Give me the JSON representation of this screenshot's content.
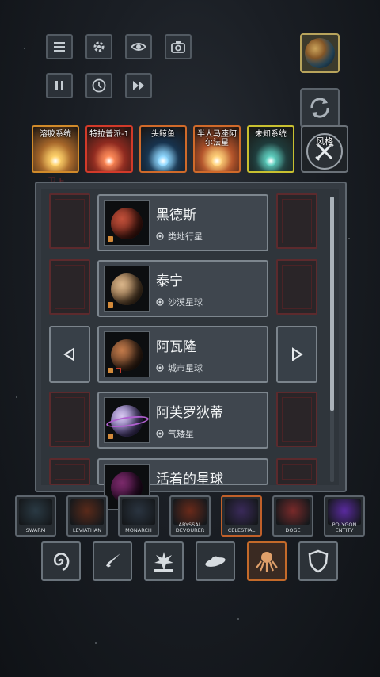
{
  "toolbar": {
    "icons": [
      "menu-icon",
      "gear-icon",
      "eye-icon",
      "camera-icon",
      "pause-icon",
      "clock-icon",
      "fast-forward-icon",
      "globe-icon",
      "refresh-icon"
    ]
  },
  "systems": [
    {
      "label": "溶胶系统",
      "border": "#d08a2a",
      "bg": "#a6662a",
      "sun": "#ffd36b"
    },
    {
      "label": "特拉普派-1",
      "border": "#d23a2a",
      "bg": "#8f2a20",
      "sun": "#ff8c5a"
    },
    {
      "label": "头鲸鱼",
      "border": "#d06a2a",
      "bg": "#17324d",
      "sun": "#8fd8ff"
    },
    {
      "label": "半人马座阿尔法星",
      "border": "#d06a2a",
      "bg": "#b3522a",
      "sun": "#ffd27a"
    },
    {
      "label": "未知系统",
      "border": "#c8c030",
      "bg": "#1f3a3a",
      "sun": "#5fd0c0"
    }
  ],
  "style_button": {
    "label": "风格"
  },
  "faded_label": "卫 E",
  "planets": [
    {
      "name": "黑德斯",
      "type": "类地行星",
      "type_icon": "gauge-icon",
      "color1": "#c0503a",
      "color2": "#5a1a12"
    },
    {
      "name": "泰宁",
      "type": "沙漠星球",
      "type_icon": "target-icon",
      "color1": "#d9b58a",
      "color2": "#6a4a2a"
    },
    {
      "name": "阿瓦隆",
      "type": "城市星球",
      "type_icon": "city-icon",
      "color1": "#c27a4a",
      "color2": "#3a2418"
    },
    {
      "name": "阿芙罗狄蒂",
      "type": "气矮星",
      "type_icon": "striped-globe-icon",
      "color1": "#d8c8f0",
      "color2": "#4a3a8a"
    },
    {
      "name": "活着的星球",
      "type": "",
      "type_icon": "",
      "color1": "#7a2a6a",
      "color2": "#2a0a2a"
    }
  ],
  "factions": [
    {
      "label": "SWARM",
      "art": "#2a3a44",
      "highlight": false
    },
    {
      "label": "LEVIATHAN",
      "art": "#5a2a1a",
      "highlight": false
    },
    {
      "label": "MONARCH",
      "art": "#2a3440",
      "highlight": false
    },
    {
      "label": "ABYSSAL DEVOURER",
      "art": "#6a2a1a",
      "highlight": false
    },
    {
      "label": "CELESTIAL",
      "art": "#3a2a5a",
      "highlight": true
    },
    {
      "label": "DOGE",
      "art": "#7a2a2a",
      "highlight": false
    },
    {
      "label": "POLYGON ENTITY",
      "art": "#5a2aa0",
      "highlight": false
    }
  ],
  "categories": [
    "spiral-galaxy-icon",
    "missile-icon",
    "explosion-icon",
    "ufo-icon",
    "octopus-icon",
    "shield-icon"
  ]
}
